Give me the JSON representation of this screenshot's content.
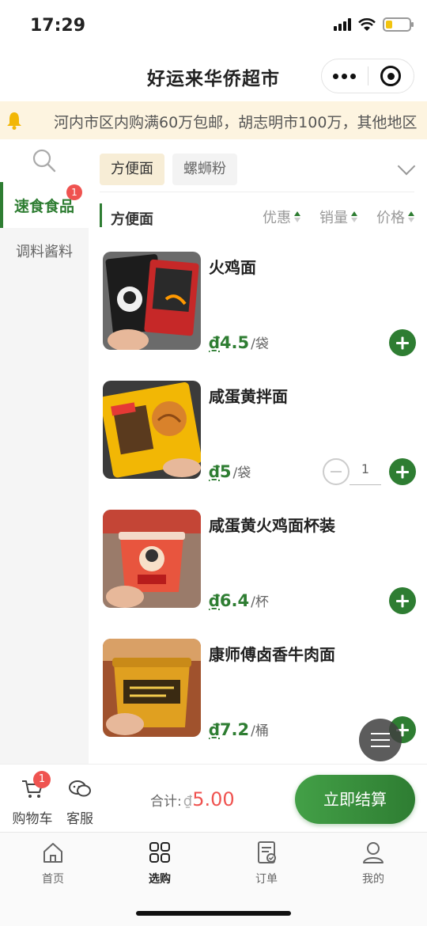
{
  "status_bar": {
    "time": "17:29"
  },
  "header": {
    "title": "好运来华侨超市"
  },
  "notice": {
    "text": "河内市区内购满60万包邮，胡志明市100万，其他地区"
  },
  "sidebar": {
    "items": [
      {
        "label": "速食食品",
        "badge": "1",
        "active": true
      },
      {
        "label": "调料酱料",
        "badge": "",
        "active": false
      }
    ]
  },
  "tabs": [
    {
      "label": "方便面",
      "active": true
    },
    {
      "label": "螺蛳粉",
      "active": false
    }
  ],
  "section": {
    "title": "方便面",
    "sorts": [
      "优惠",
      "销量",
      "价格"
    ]
  },
  "products": [
    {
      "name": "火鸡面",
      "currency": "₫",
      "price": "4.5",
      "unit": "/袋",
      "qty": ""
    },
    {
      "name": "咸蛋黄拌面",
      "currency": "₫",
      "price": "5",
      "unit": "/袋",
      "qty": "1"
    },
    {
      "name": "咸蛋黄火鸡面杯装",
      "currency": "₫",
      "price": "6.4",
      "unit": "/杯",
      "qty": ""
    },
    {
      "name": "康师傅卤香牛肉面",
      "currency": "₫",
      "price": "7.2",
      "unit": "/桶",
      "qty": ""
    }
  ],
  "cart": {
    "cart_label": "购物车",
    "cart_badge": "1",
    "service_label": "客服",
    "total_label": "合计:",
    "total_currency": "₫",
    "total_amount": "5.00",
    "checkout_label": "立即结算"
  },
  "bottom_nav": [
    {
      "label": "首页",
      "icon": "home-icon",
      "active": false
    },
    {
      "label": "选购",
      "icon": "grid-icon",
      "active": true
    },
    {
      "label": "订单",
      "icon": "order-icon",
      "active": false
    },
    {
      "label": "我的",
      "icon": "user-icon",
      "active": false
    }
  ],
  "colors": {
    "accent": "#2e7d32",
    "price": "#2e7d32",
    "badge": "#ef5350",
    "notice_bg": "#fdf4e0"
  }
}
